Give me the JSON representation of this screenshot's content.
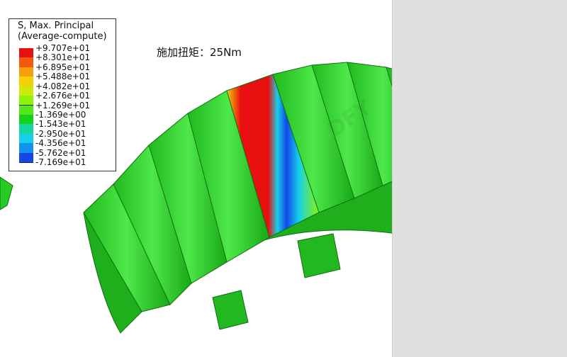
{
  "legend": {
    "title_line1": "S, Max. Principal",
    "title_line2": "(Average-compute)",
    "ticks": [
      "+9.707e+01",
      "+8.301e+01",
      "+6.895e+01",
      "+5.488e+01",
      "+4.082e+01",
      "+2.676e+01",
      "+1.269e+01",
      "-1.369e+00",
      "-1.543e+01",
      "-2.950e+01",
      "-4.356e+01",
      "-5.762e+01",
      "-7.169e+01"
    ],
    "colors": [
      "#e81010",
      "#f25a0a",
      "#f7a00a",
      "#f2d10a",
      "#c9ec0a",
      "#8ff20a",
      "#4fe81a",
      "#14d21a",
      "#14d8a0",
      "#14d0ea",
      "#1492f0",
      "#1446e8"
    ]
  },
  "annotation": "施加扭矩：25Nm",
  "watermark": "DFY",
  "colors": {
    "gear_main": "#26cc24",
    "gear_dark": "#1aa018",
    "gear_light": "#6af06a",
    "stress_red": "#e81010",
    "stress_blue": "#1446e8",
    "side_panel": "#e0e0e0"
  }
}
